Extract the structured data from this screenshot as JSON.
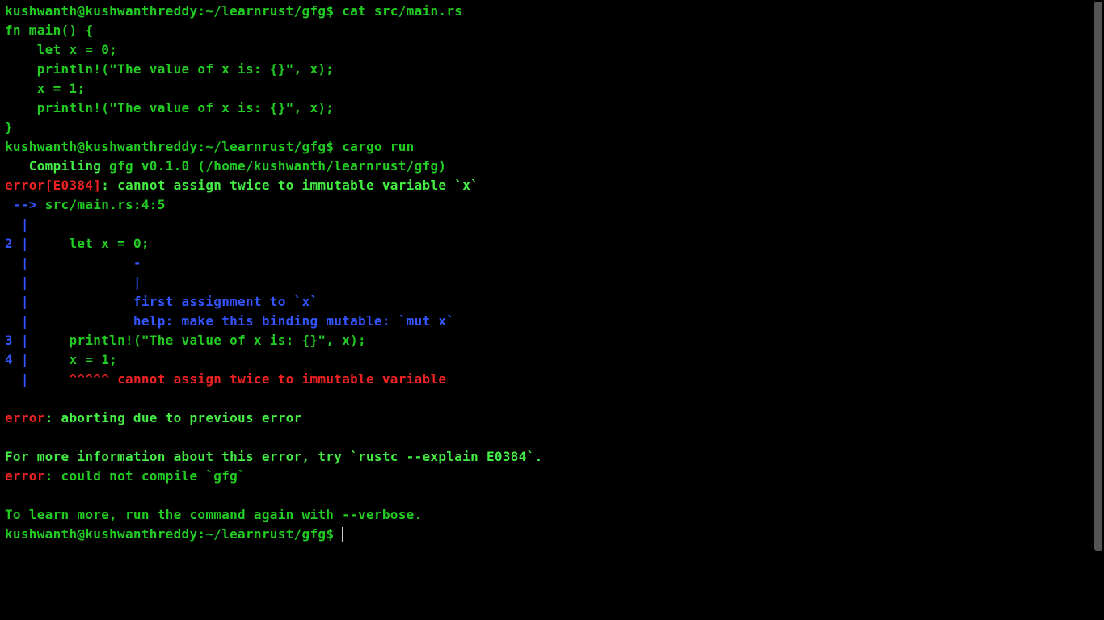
{
  "prompt1_user": "kushwanth@kushwanthreddy",
  "prompt1_path": ":~/learnrust/gfg",
  "prompt1_dollar": "$ ",
  "cmd1": "cat src/main.rs",
  "src_line1": "fn main() {",
  "src_line2": "    let x = 0;",
  "src_line3": "    println!(\"The value of x is: {}\", x);",
  "src_line4": "    x = 1;",
  "src_line5": "    println!(\"The value of x is: {}\", x);",
  "src_line6": "}",
  "prompt2_user": "kushwanth@kushwanthreddy",
  "prompt2_path": ":~/learnrust/gfg",
  "prompt2_dollar": "$ ",
  "cmd2": "cargo run",
  "compiling_label": "   Compiling",
  "compiling_rest": " gfg v0.1.0 (/home/kushwanth/learnrust/gfg)",
  "err_word": "error",
  "err_code_open": "[",
  "err_code": "E0384",
  "err_code_close": "]",
  "err_msg": ": cannot assign twice to immutable variable `x`",
  "loc_arrow": " --> ",
  "loc_file": "src/main.rs:4:5",
  "bar_only": "  | ",
  "lineno2": "2 ",
  "bar": "| ",
  "code_l2": "    let x = 0;",
  "marker_dash": "            -",
  "marker_pipe": "            |",
  "note_first": "            first assignment to `x`",
  "note_help": "            help: make this binding mutable: `mut x`",
  "lineno3": "3 ",
  "code_l3": "    println!(\"The value of x is: {}\", x);",
  "lineno4": "4 ",
  "code_l4": "    x = 1;",
  "carets_pad": "    ",
  "carets": "^^^^^",
  "carets_msg": " cannot assign twice to immutable variable",
  "err2_word": "error",
  "err2_msg": ": aborting due to previous error",
  "moreinfo": "For more information about this error, try `rustc --explain E0384`.",
  "err3_word": "error",
  "err3_msg": ": could not compile `gfg`",
  "learn_more": "To learn more, run the command again with --verbose.",
  "prompt3_user": "kushwanth@kushwanthreddy",
  "prompt3_path": ":~/learnrust/gfg",
  "prompt3_dollar": "$ "
}
